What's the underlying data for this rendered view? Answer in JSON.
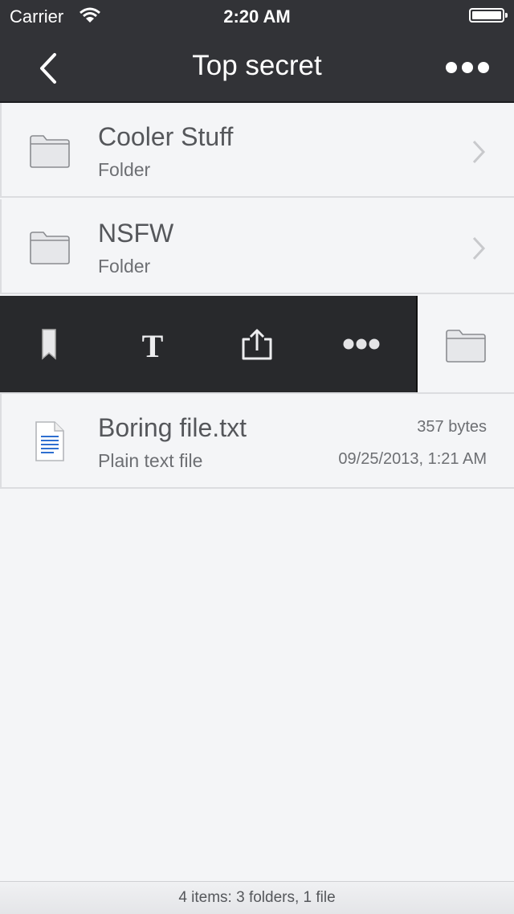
{
  "status_bar": {
    "carrier": "Carrier",
    "time": "2:20 AM"
  },
  "nav": {
    "title": "Top secret"
  },
  "items": [
    {
      "name": "Cooler Stuff",
      "type": "Folder"
    },
    {
      "name": "NSFW",
      "type": "Folder"
    }
  ],
  "action_bar": {
    "actions": [
      "bookmark-icon",
      "text-format-icon",
      "share-icon",
      "more-icon"
    ]
  },
  "files": [
    {
      "name": "Boring file.txt",
      "type": "Plain text file",
      "size": "357 bytes",
      "modified": "09/25/2013, 1:21 AM"
    }
  ],
  "footer": {
    "summary": "4 items: 3 folders, 1 file"
  },
  "colors": {
    "nav_bg": "#323337",
    "action_bg": "#28292c",
    "list_bg": "#f4f5f7"
  }
}
